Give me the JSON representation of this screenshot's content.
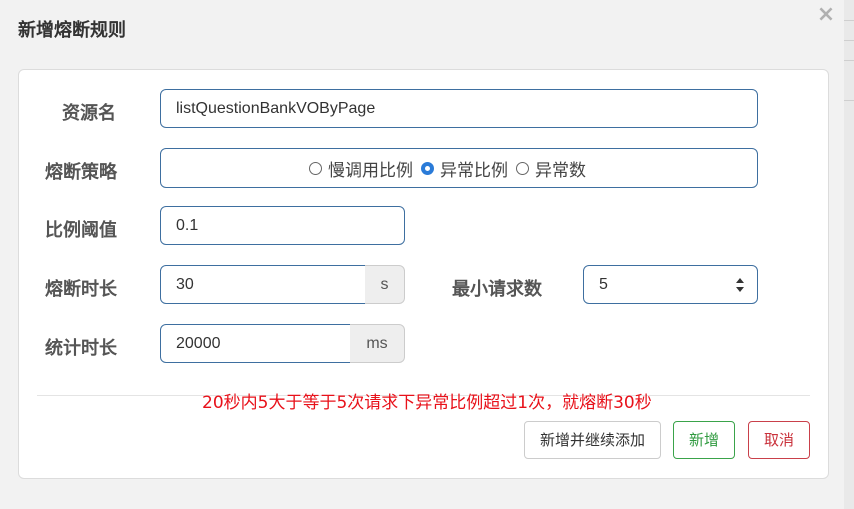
{
  "dialog": {
    "title": "新增熔断规则",
    "close_glyph": "×"
  },
  "form": {
    "resource": {
      "label": "资源名",
      "value": "listQuestionBankVOByPage"
    },
    "strategy": {
      "label": "熔断策略",
      "options": [
        "慢调用比例",
        "异常比例",
        "异常数"
      ],
      "selected": "异常比例"
    },
    "threshold": {
      "label": "比例阈值",
      "value": "0.1"
    },
    "duration": {
      "label": "熔断时长",
      "value": "30",
      "unit": "s"
    },
    "min_requests": {
      "label": "最小请求数",
      "value": "5"
    },
    "stat_interval": {
      "label": "统计时长",
      "value": "20000",
      "unit": "ms"
    }
  },
  "hint": "20秒内5大于等于5次请求下异常比例超过1次，就熔断30秒",
  "buttons": {
    "add_continue": "新增并继续添加",
    "add": "新增",
    "cancel": "取消"
  },
  "colors": {
    "accent_border": "#3e6fa0",
    "hint_text": "#e8111a",
    "success": "#3aa34a",
    "danger": "#c9404a"
  },
  "icons": {
    "close": "close-icon",
    "stepper": "number-stepper-icon"
  }
}
